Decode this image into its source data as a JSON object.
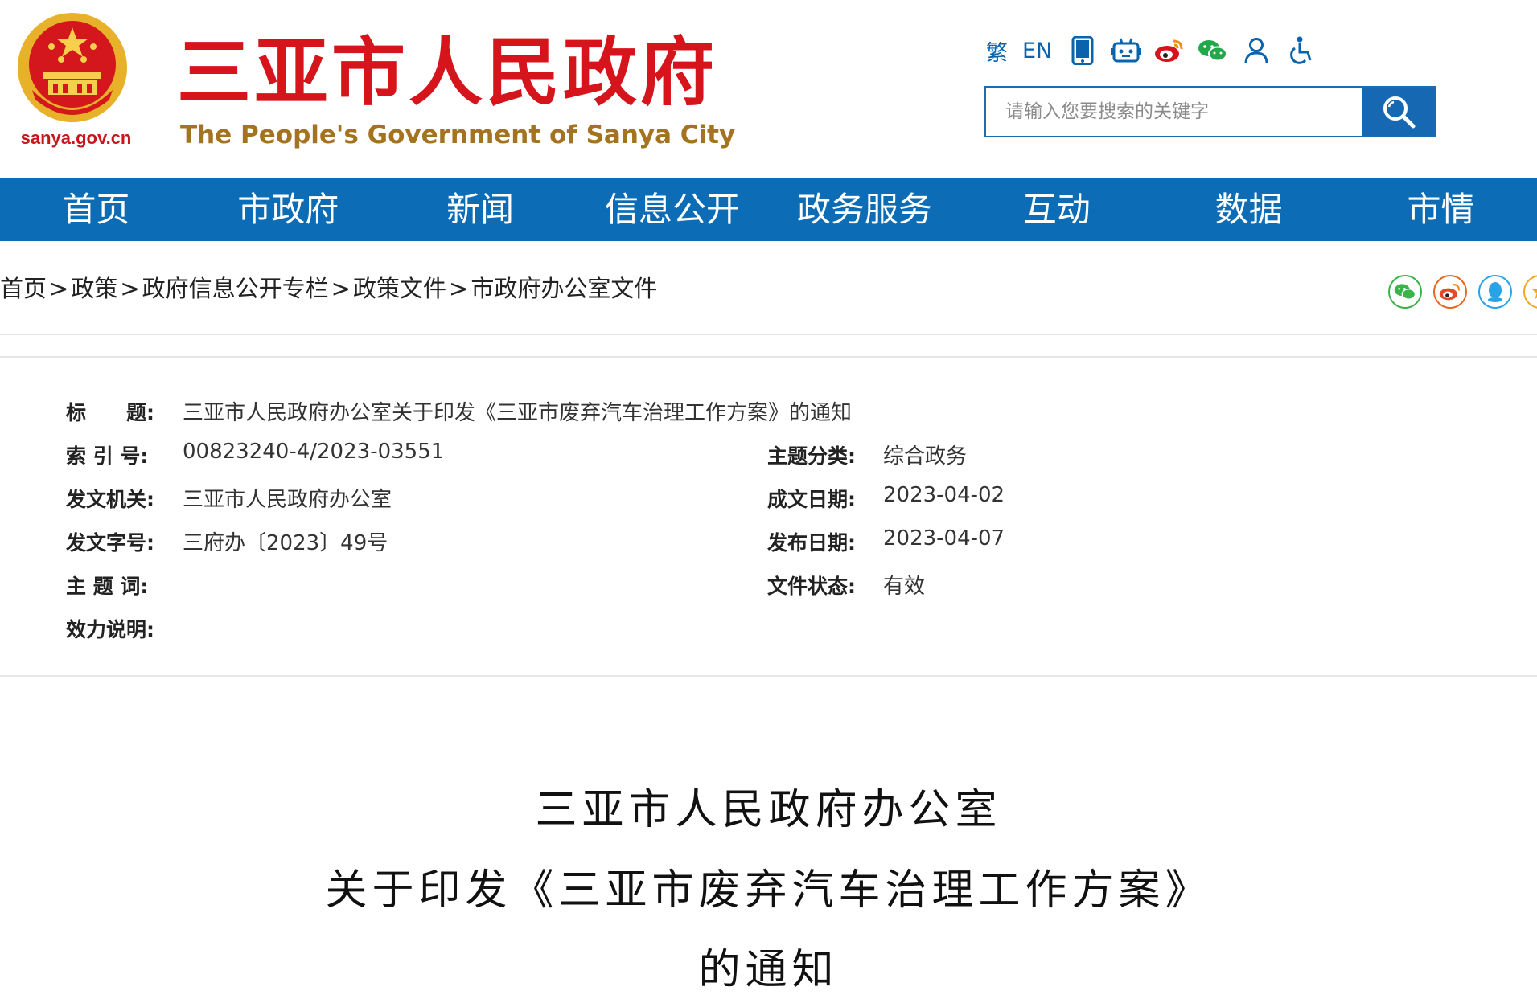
{
  "header": {
    "site_title": "三亚市人民政府",
    "site_subtitle": "The People's Government of Sanya City",
    "domain": "sanya.gov.cn",
    "toolbar": {
      "traditional": "繁",
      "english": "EN"
    },
    "search": {
      "placeholder": "请输入您要搜索的关键字"
    }
  },
  "nav": {
    "items": [
      "首页",
      "市政府",
      "新闻",
      "信息公开",
      "政务服务",
      "互动",
      "数据",
      "市情"
    ]
  },
  "breadcrumb": {
    "items": [
      "首页",
      "政策",
      "政府信息公开专栏",
      "政策文件",
      "市政府办公室文件"
    ],
    "separator": ">"
  },
  "meta": {
    "title_label": "标　　题:",
    "title_value": "三亚市人民政府办公室关于印发《三亚市废弃汽车治理工作方案》的通知",
    "index_label": "索 引 号:",
    "index_value": "00823240-4/2023-03551",
    "topic_label": "主题分类:",
    "topic_value": "综合政务",
    "issuer_label": "发文机关:",
    "issuer_value": "三亚市人民政府办公室",
    "written_label": "成文日期:",
    "written_value": "2023-04-02",
    "docno_label": "发文字号:",
    "docno_value": "三府办〔2023〕49号",
    "published_label": "发布日期:",
    "published_value": "2023-04-07",
    "keywords_label": "主 题 词:",
    "keywords_value": "",
    "status_label": "文件状态:",
    "status_value": "有效",
    "validity_label": "效力说明:",
    "validity_value": ""
  },
  "document": {
    "title_line1": "三亚市人民政府办公室",
    "title_line2": "关于印发《三亚市废弃汽车治理工作方案》",
    "title_line3": "的通知"
  },
  "colors": {
    "brand_red": "#d6141b",
    "nav_blue": "#0d6cb6",
    "gold": "#a3731f"
  }
}
